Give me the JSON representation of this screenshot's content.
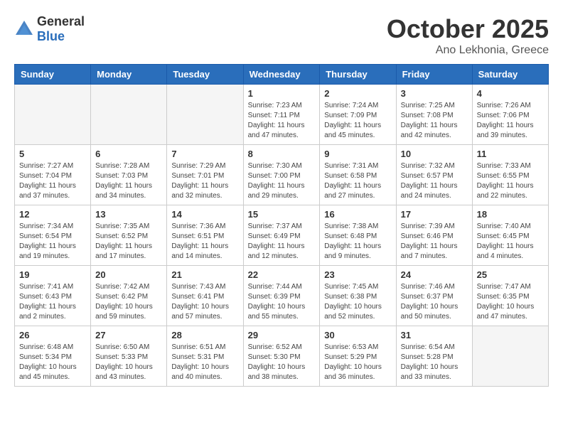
{
  "header": {
    "logo_general": "General",
    "logo_blue": "Blue",
    "title": "October 2025",
    "subtitle": "Ano Lekhonia, Greece"
  },
  "weekdays": [
    "Sunday",
    "Monday",
    "Tuesday",
    "Wednesday",
    "Thursday",
    "Friday",
    "Saturday"
  ],
  "weeks": [
    [
      {
        "day": "",
        "info": ""
      },
      {
        "day": "",
        "info": ""
      },
      {
        "day": "",
        "info": ""
      },
      {
        "day": "1",
        "info": "Sunrise: 7:23 AM\nSunset: 7:11 PM\nDaylight: 11 hours and 47 minutes."
      },
      {
        "day": "2",
        "info": "Sunrise: 7:24 AM\nSunset: 7:09 PM\nDaylight: 11 hours and 45 minutes."
      },
      {
        "day": "3",
        "info": "Sunrise: 7:25 AM\nSunset: 7:08 PM\nDaylight: 11 hours and 42 minutes."
      },
      {
        "day": "4",
        "info": "Sunrise: 7:26 AM\nSunset: 7:06 PM\nDaylight: 11 hours and 39 minutes."
      }
    ],
    [
      {
        "day": "5",
        "info": "Sunrise: 7:27 AM\nSunset: 7:04 PM\nDaylight: 11 hours and 37 minutes."
      },
      {
        "day": "6",
        "info": "Sunrise: 7:28 AM\nSunset: 7:03 PM\nDaylight: 11 hours and 34 minutes."
      },
      {
        "day": "7",
        "info": "Sunrise: 7:29 AM\nSunset: 7:01 PM\nDaylight: 11 hours and 32 minutes."
      },
      {
        "day": "8",
        "info": "Sunrise: 7:30 AM\nSunset: 7:00 PM\nDaylight: 11 hours and 29 minutes."
      },
      {
        "day": "9",
        "info": "Sunrise: 7:31 AM\nSunset: 6:58 PM\nDaylight: 11 hours and 27 minutes."
      },
      {
        "day": "10",
        "info": "Sunrise: 7:32 AM\nSunset: 6:57 PM\nDaylight: 11 hours and 24 minutes."
      },
      {
        "day": "11",
        "info": "Sunrise: 7:33 AM\nSunset: 6:55 PM\nDaylight: 11 hours and 22 minutes."
      }
    ],
    [
      {
        "day": "12",
        "info": "Sunrise: 7:34 AM\nSunset: 6:54 PM\nDaylight: 11 hours and 19 minutes."
      },
      {
        "day": "13",
        "info": "Sunrise: 7:35 AM\nSunset: 6:52 PM\nDaylight: 11 hours and 17 minutes."
      },
      {
        "day": "14",
        "info": "Sunrise: 7:36 AM\nSunset: 6:51 PM\nDaylight: 11 hours and 14 minutes."
      },
      {
        "day": "15",
        "info": "Sunrise: 7:37 AM\nSunset: 6:49 PM\nDaylight: 11 hours and 12 minutes."
      },
      {
        "day": "16",
        "info": "Sunrise: 7:38 AM\nSunset: 6:48 PM\nDaylight: 11 hours and 9 minutes."
      },
      {
        "day": "17",
        "info": "Sunrise: 7:39 AM\nSunset: 6:46 PM\nDaylight: 11 hours and 7 minutes."
      },
      {
        "day": "18",
        "info": "Sunrise: 7:40 AM\nSunset: 6:45 PM\nDaylight: 11 hours and 4 minutes."
      }
    ],
    [
      {
        "day": "19",
        "info": "Sunrise: 7:41 AM\nSunset: 6:43 PM\nDaylight: 11 hours and 2 minutes."
      },
      {
        "day": "20",
        "info": "Sunrise: 7:42 AM\nSunset: 6:42 PM\nDaylight: 10 hours and 59 minutes."
      },
      {
        "day": "21",
        "info": "Sunrise: 7:43 AM\nSunset: 6:41 PM\nDaylight: 10 hours and 57 minutes."
      },
      {
        "day": "22",
        "info": "Sunrise: 7:44 AM\nSunset: 6:39 PM\nDaylight: 10 hours and 55 minutes."
      },
      {
        "day": "23",
        "info": "Sunrise: 7:45 AM\nSunset: 6:38 PM\nDaylight: 10 hours and 52 minutes."
      },
      {
        "day": "24",
        "info": "Sunrise: 7:46 AM\nSunset: 6:37 PM\nDaylight: 10 hours and 50 minutes."
      },
      {
        "day": "25",
        "info": "Sunrise: 7:47 AM\nSunset: 6:35 PM\nDaylight: 10 hours and 47 minutes."
      }
    ],
    [
      {
        "day": "26",
        "info": "Sunrise: 6:48 AM\nSunset: 5:34 PM\nDaylight: 10 hours and 45 minutes."
      },
      {
        "day": "27",
        "info": "Sunrise: 6:50 AM\nSunset: 5:33 PM\nDaylight: 10 hours and 43 minutes."
      },
      {
        "day": "28",
        "info": "Sunrise: 6:51 AM\nSunset: 5:31 PM\nDaylight: 10 hours and 40 minutes."
      },
      {
        "day": "29",
        "info": "Sunrise: 6:52 AM\nSunset: 5:30 PM\nDaylight: 10 hours and 38 minutes."
      },
      {
        "day": "30",
        "info": "Sunrise: 6:53 AM\nSunset: 5:29 PM\nDaylight: 10 hours and 36 minutes."
      },
      {
        "day": "31",
        "info": "Sunrise: 6:54 AM\nSunset: 5:28 PM\nDaylight: 10 hours and 33 minutes."
      },
      {
        "day": "",
        "info": ""
      }
    ]
  ]
}
